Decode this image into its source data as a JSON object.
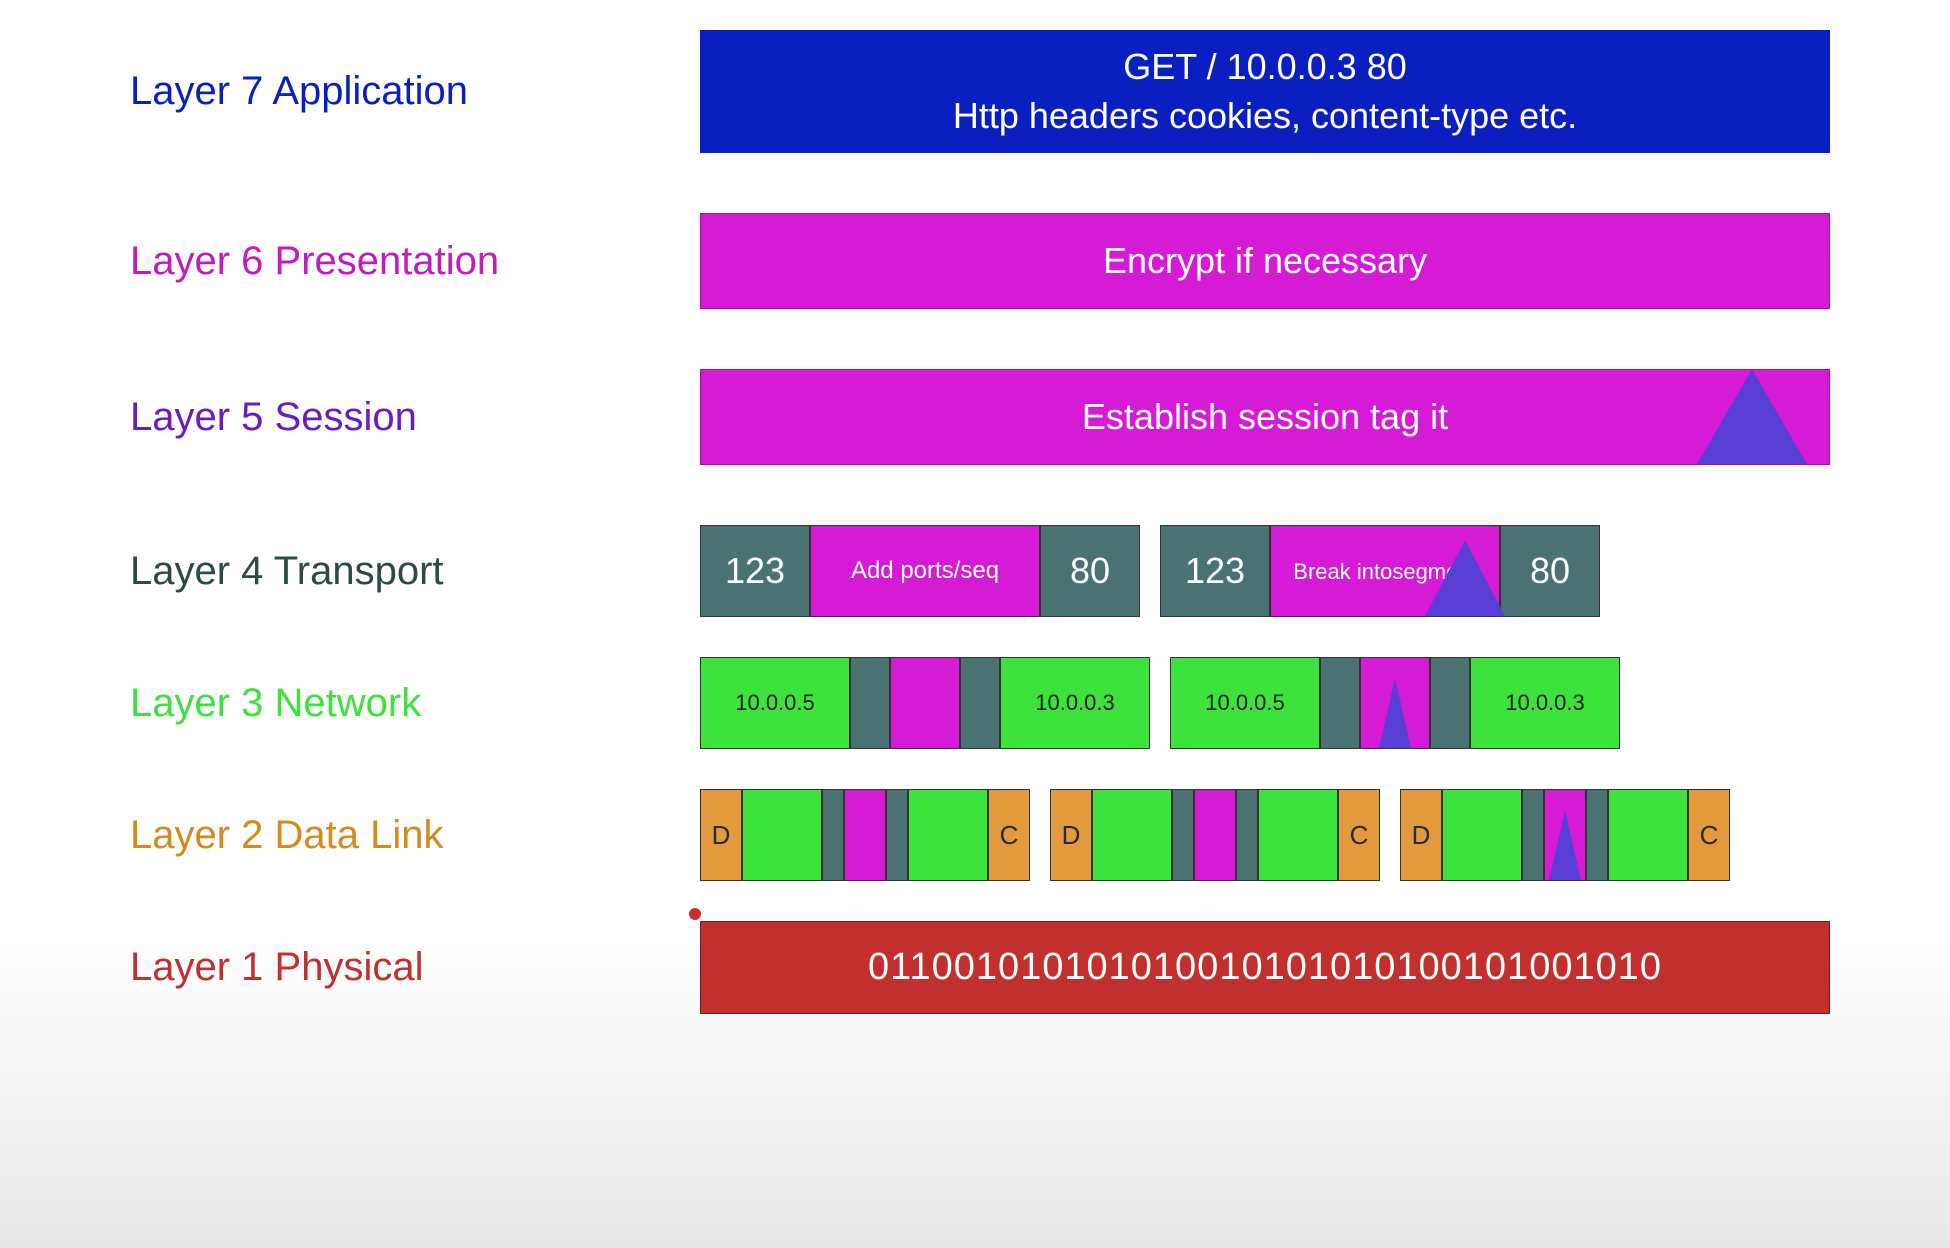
{
  "layers": {
    "l7": {
      "label": "Layer 7 Application",
      "line1": "GET / 10.0.0.3 80",
      "line2": "Http headers cookies, content-type etc."
    },
    "l6": {
      "label": "Layer 6 Presentation",
      "text": "Encrypt if necessary"
    },
    "l5": {
      "label": "Layer 5 Session",
      "text": "Establish session tag it"
    },
    "l4": {
      "label": "Layer 4 Transport",
      "segA": {
        "left": "123",
        "mid": "Add ports/seq",
        "right": "80"
      },
      "segB": {
        "left": "123",
        "mid_l1": "Break into",
        "mid_l2": "segment",
        "right": "80"
      }
    },
    "l3": {
      "label": "Layer 3 Network",
      "pktA": {
        "src": "10.0.0.5",
        "dst": "10.0.0.3"
      },
      "pktB": {
        "src": "10.0.0.5",
        "dst": "10.0.0.3"
      }
    },
    "l2": {
      "label": "Layer 2 Data Link",
      "frame": {
        "d": "D",
        "c": "C"
      }
    },
    "l1": {
      "label": "Layer 1 Physical",
      "bits": "011001010101010010101010100101001010"
    }
  }
}
